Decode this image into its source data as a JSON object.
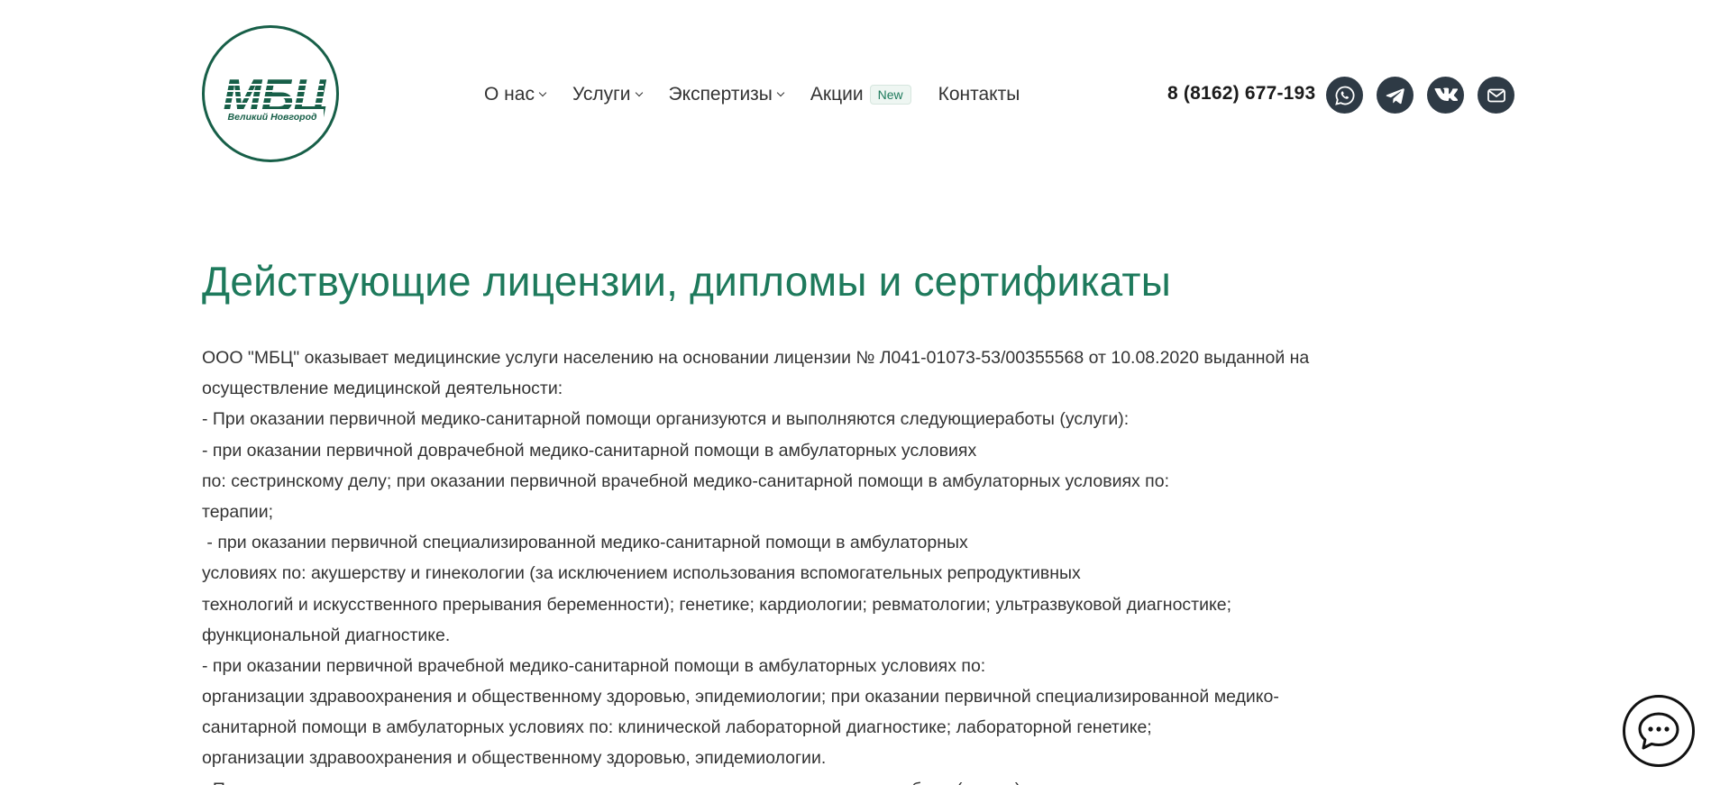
{
  "header": {
    "logo": {
      "mark": "МБЦ",
      "subtitle": "Великий Новгород"
    },
    "nav": [
      {
        "label": "О нас",
        "dropdown": true
      },
      {
        "label": "Услуги",
        "dropdown": true
      },
      {
        "label": "Экспертизы",
        "dropdown": true
      },
      {
        "label": "Акции",
        "badge": "New"
      },
      {
        "label": "Контакты"
      }
    ],
    "phone": "8 (8162) 677-193",
    "social": [
      "whatsapp-icon",
      "telegram-icon",
      "vk-icon",
      "mail-icon"
    ]
  },
  "main": {
    "title": "Действующие лицензии, дипломы и сертификаты",
    "lines": [
      "ООО \"МБЦ\" оказывает медицинские услуги населению на основании лицензии № Л041-01073-53/00355568 от 10.08.2020 выданной на",
      "осуществление медицинской деятельности:",
      "- При оказании первичной медико-санитарной помощи организуются и выполняются следующиеработы (услуги):",
      "- при оказании первичной доврачебной медико-санитарной помощи в амбулаторных условиях",
      "по: сестринскому делу; при оказании первичной врачебной медико-санитарной помощи в амбулаторных условиях по:",
      "терапии;",
      " - при оказании первичной специализированной медико-санитарной помощи в амбулаторных",
      "условиях по: акушерству и гинекологии (за исключением использования вспомогательных репродуктивных",
      "технологий и искусственного прерывания беременности); генетике; кардиологии; ревматологии; ультразвуковой диагностике;",
      "функциональной диагностике.",
      "- при оказании первичной врачебной медико-санитарной помощи в амбулаторных условиях по:",
      "организации здравоохранения и общественному здоровью, эпидемиологии; при оказании первичной специализированной медико-",
      "санитарной помощи в амбулаторных условиях по: клинической лабораторной диагностике; лабораторной генетике;",
      "организации здравоохранения и общественному здоровью, эпидемиологии.",
      "- При проведении медицинских экспертиз организуются и выполняются следующие работы (услуги) по:"
    ]
  },
  "colors": {
    "brand": "#175f48",
    "title": "#1e7a5c",
    "social_bg": "#2e3a45"
  }
}
